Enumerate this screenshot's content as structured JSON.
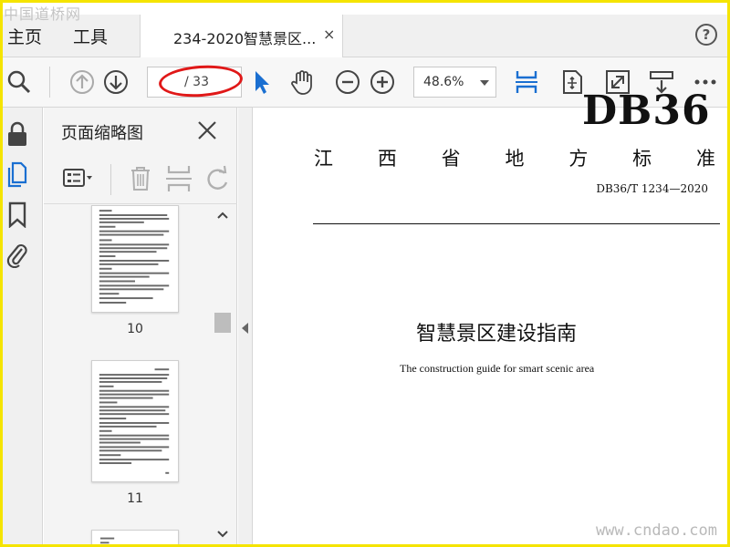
{
  "watermark_top": "中国道桥网",
  "watermark_bottom": "www.cndao.com",
  "menu": {
    "home": "主页",
    "tools": "工具"
  },
  "tab": {
    "label": "234-2020智慧景区...",
    "close": "×"
  },
  "help": {
    "label": "?"
  },
  "toolbar": {
    "page_current": "",
    "page_total": "/ 33",
    "zoom": "48.6%"
  },
  "sidebar": {
    "title": "页面缩略图",
    "thumbnails": [
      {
        "page": "10"
      },
      {
        "page": "11"
      }
    ]
  },
  "document": {
    "logo": "DB36",
    "title_cn": [
      "江",
      "西",
      "省",
      "地",
      "方",
      "标",
      "准"
    ],
    "code": "DB36/T 1234—2020",
    "main_title": "智慧景区建设指南",
    "subtitle": "The construction guide for smart scenic area"
  },
  "colors": {
    "accent": "#1a6fd1",
    "annotation": "#e01818",
    "frame": "#f5e400"
  }
}
